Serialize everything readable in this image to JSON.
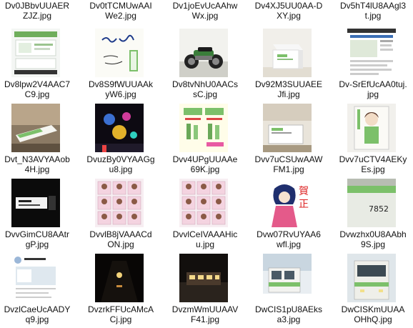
{
  "files": [
    {
      "name": "Dv0JBbvUUAERZJZ.jpg",
      "thumb": "none"
    },
    {
      "name": "Dv0tTCMUwAAIWe2.jpg",
      "thumb": "none"
    },
    {
      "name": "Dv1joEvUcAAhwWx.jpg",
      "thumb": "none"
    },
    {
      "name": "Dv4XJ5UU0AA-DXY.jpg",
      "thumb": "none"
    },
    {
      "name": "Dv5hT4lU8AAgl3t.jpg",
      "thumb": "none"
    },
    {
      "name": "Dv8lpw2V4AAC7C9.jpg",
      "thumb": "app-screenshot"
    },
    {
      "name": "Dv8S9fWUUAAkyW6.jpg",
      "thumb": "handwriting"
    },
    {
      "name": "Dv8tvNhU0AACssC.jpg",
      "thumb": "motorcycle"
    },
    {
      "name": "Dv92M3SUUAEEJfi.jpg",
      "thumb": "tissue-box"
    },
    {
      "name": "Dv-SrEfUcAA0tuj.jpg",
      "thumb": "web-page"
    },
    {
      "name": "Dvt_N3AVYAAob4H.jpg",
      "thumb": "sofa-card"
    },
    {
      "name": "DvuzBy0VYAAGgu8.jpg",
      "thumb": "neon-night"
    },
    {
      "name": "Dvv4UPgUUAAe69K.jpg",
      "thumb": "flyer"
    },
    {
      "name": "Dvv7uCSUwAAWFM1.jpg",
      "thumb": "box-shelf"
    },
    {
      "name": "Dvv7uCTV4AEKyEs.jpg",
      "thumb": "anime-poster"
    },
    {
      "name": "DvvGimCU8AAtrgP.jpg",
      "thumb": "dark-sign"
    },
    {
      "name": "DvvlB8jVAAACdON.jpg",
      "thumb": "card-grid"
    },
    {
      "name": "DvvlCeIVAAAHicu.jpg",
      "thumb": "card-grid"
    },
    {
      "name": "Dvw07RvUYAA6wfl.jpg",
      "thumb": "new-year-girl"
    },
    {
      "name": "Dvwzhx0U8AAbh9S.jpg",
      "thumb": "train-number"
    },
    {
      "name": "DvzlCaeUcAADYq9.jpg",
      "thumb": "tweet"
    },
    {
      "name": "DvzrkFFUcAMcACj.jpg",
      "thumb": "dark-tunnel"
    },
    {
      "name": "DvzmWmUUAAVF41.jpg",
      "thumb": "night-platform"
    },
    {
      "name": "DwCIS1pU8AEksa3.jpg",
      "thumb": "snow-train"
    },
    {
      "name": "DwCISKmUUAAOHhQ.jpg",
      "thumb": "train-front"
    }
  ],
  "accent": {
    "green": "#7cc06a",
    "selected_bg": "#cce8ff"
  }
}
